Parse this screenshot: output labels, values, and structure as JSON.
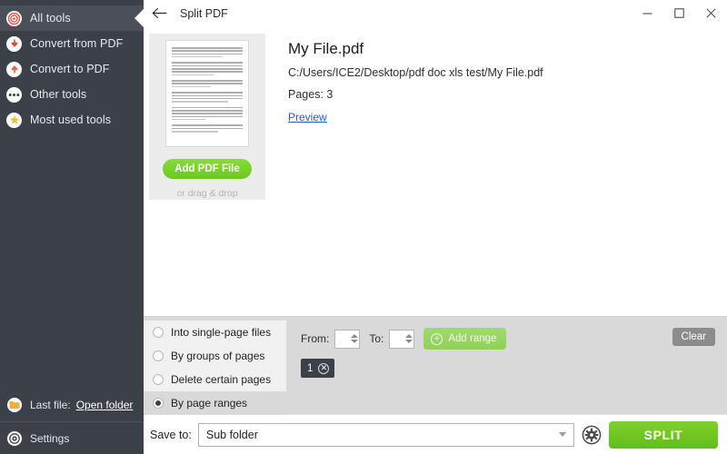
{
  "window": {
    "title": "Split PDF",
    "back_icon": "back-arrow-icon",
    "minimize_label": "─",
    "maximize_label": "☐",
    "close_label": "✕"
  },
  "sidebar": {
    "items": [
      {
        "label": "All tools",
        "icon": "target-icon",
        "active": true
      },
      {
        "label": "Convert from PDF",
        "icon": "arrow-down-icon",
        "active": false
      },
      {
        "label": "Convert to PDF",
        "icon": "arrow-up-icon",
        "active": false
      },
      {
        "label": "Other tools",
        "icon": "ellipsis-icon",
        "active": false
      },
      {
        "label": "Most used tools",
        "icon": "star-icon",
        "active": false
      }
    ],
    "last_file_label": "Last file:",
    "open_folder_label": "Open folder",
    "folder_icon": "folder-icon",
    "settings_label": "Settings",
    "settings_icon": "gear-icon"
  },
  "file": {
    "name": "My File.pdf",
    "path": "C:/Users/ICE2/Desktop/pdf doc xls test/My File.pdf",
    "pages": "Pages: 3",
    "preview_label": "Preview",
    "add_button_label": "Add PDF File",
    "drag_hint": "or drag & drop"
  },
  "options": {
    "radios": [
      {
        "label": "Into single-page files",
        "selected": false
      },
      {
        "label": "By groups of pages",
        "selected": false
      },
      {
        "label": "Delete certain pages",
        "selected": false
      },
      {
        "label": "By page ranges",
        "selected": true
      }
    ],
    "from_label": "From:",
    "from_value": "",
    "to_label": "To:",
    "to_value": "",
    "add_range_label": "Add range",
    "add_range_icon": "plus-circle-icon",
    "clear_label": "Clear",
    "chips": [
      {
        "label": "1",
        "remove_icon": "close-circle-icon"
      }
    ]
  },
  "action_bar": {
    "save_to_label": "Save to:",
    "save_to_value": "Sub folder",
    "save_to_options": [
      "Sub folder"
    ],
    "settings_icon": "gear-icon",
    "split_label": "SPLIT"
  },
  "colors": {
    "sidebar_bg": "#3c4049",
    "sidebar_active_bg": "#4a4f59",
    "accent_green": "#79d42b",
    "split_green": "#6cc91f",
    "panel_gray": "#d9d9d9",
    "radio_bg": "#f1f1f1",
    "link_blue": "#2a56c6",
    "chip_bg": "#3c4049",
    "clear_gray": "#8c8c8c"
  }
}
